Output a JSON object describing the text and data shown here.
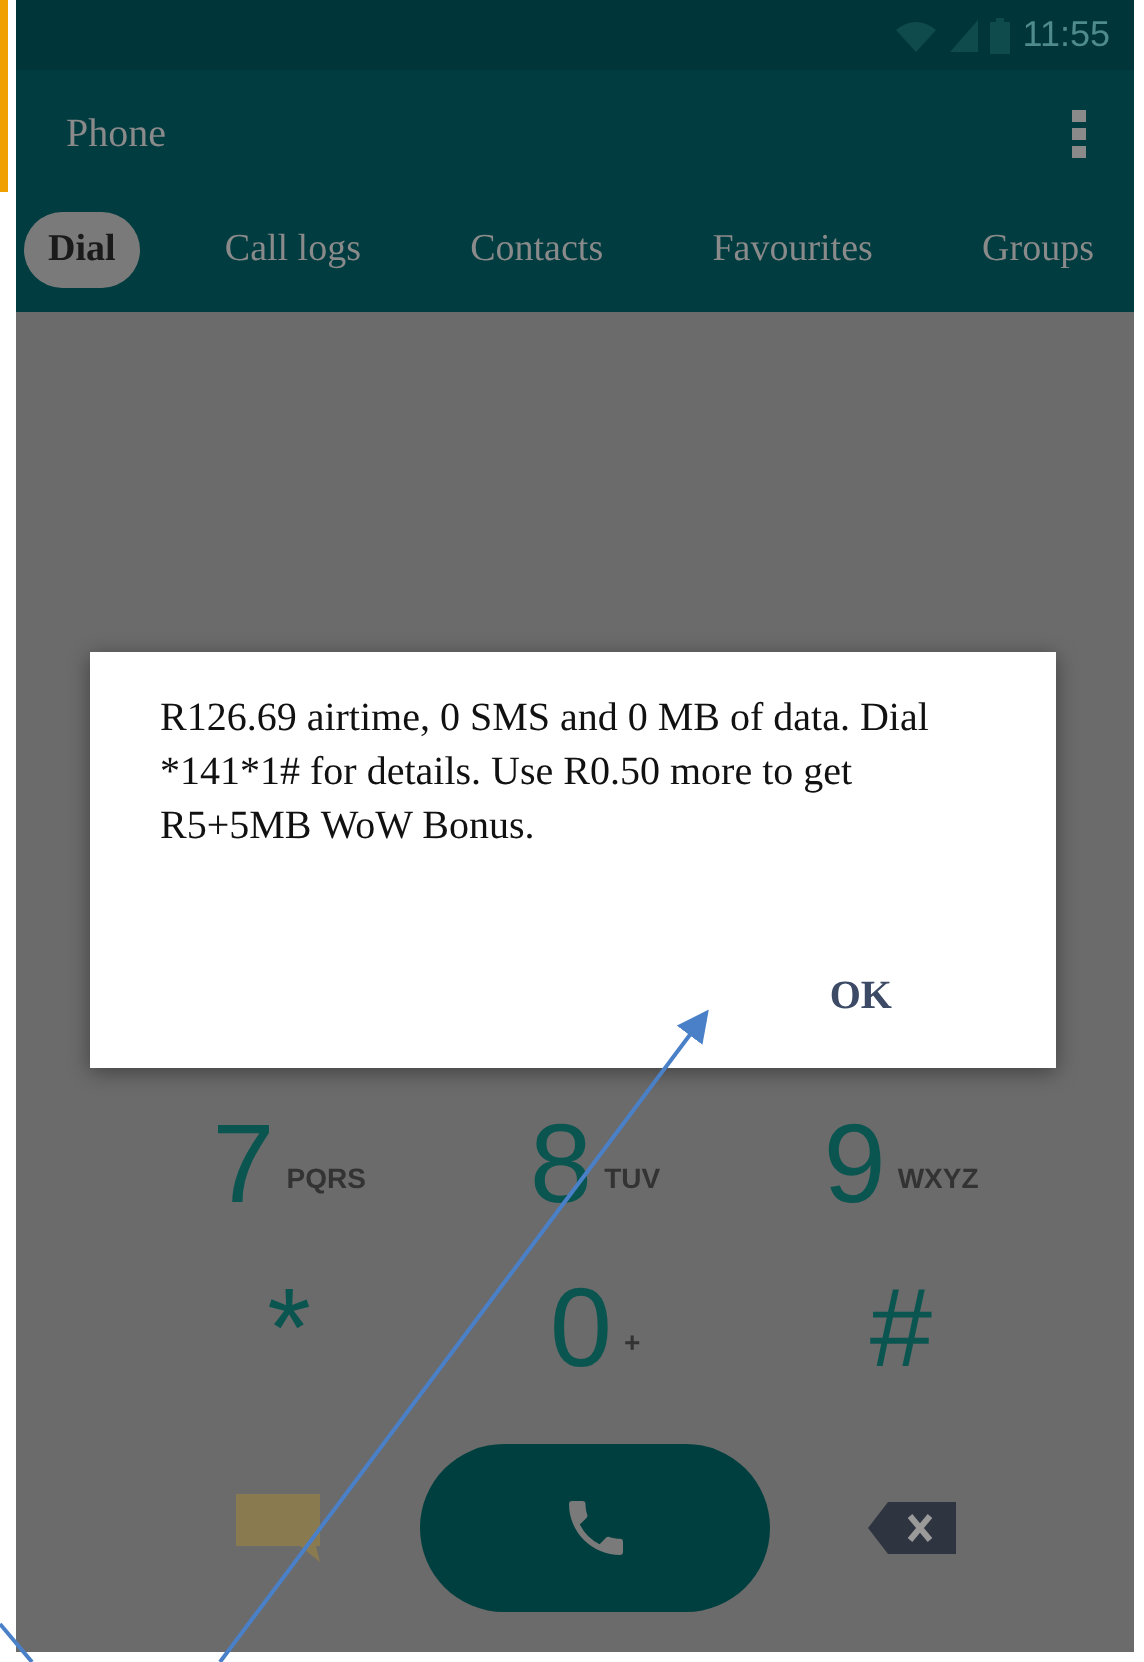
{
  "status_bar": {
    "time": "11:55"
  },
  "app_bar": {
    "title": "Phone"
  },
  "tabs": [
    {
      "label": "Dial",
      "selected": true
    },
    {
      "label": "Call logs",
      "selected": false
    },
    {
      "label": "Contacts",
      "selected": false
    },
    {
      "label": "Favourites",
      "selected": false
    },
    {
      "label": "Groups",
      "selected": false
    }
  ],
  "dialog": {
    "message": "R126.69 airtime, 0 SMS and 0 MB of data. Dial *141*1# for details. Use R0.50 more to get R5+5MB WoW Bonus.",
    "button": "OK"
  },
  "keypad": [
    {
      "key": "7",
      "letters": "PQRS"
    },
    {
      "key": "8",
      "letters": "TUV"
    },
    {
      "key": "9",
      "letters": "WXYZ"
    },
    {
      "key": "*"
    },
    {
      "key": "0",
      "letters": "+"
    },
    {
      "key": "#"
    }
  ]
}
